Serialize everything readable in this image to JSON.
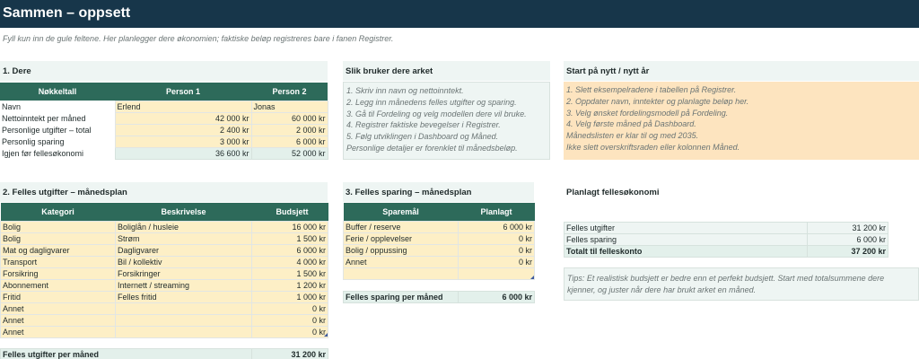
{
  "title": "Sammen – oppsett",
  "subtitle": "Fyll kun inn de gule feltene. Her planlegger dere økonomien; faktiske beløp registreres bare i fanen Registrer.",
  "section1": {
    "heading": "1. Dere",
    "headers": [
      "Nøkkeltall",
      "Person 1",
      "Person 2"
    ],
    "rows": [
      {
        "label": "Navn",
        "p1": "Erlend",
        "p2": "Jonas"
      },
      {
        "label": "Nettoinntekt per måned",
        "p1": "42 000 kr",
        "p2": "60 000 kr"
      },
      {
        "label": "Personlige utgifter – total",
        "p1": "2 400 kr",
        "p2": "2 000 kr"
      },
      {
        "label": "Personlig sparing",
        "p1": "3 000 kr",
        "p2": "6 000 kr"
      },
      {
        "label": "Igjen før felles­økonomi",
        "p1": "36 600 kr",
        "p2": "52 000 kr"
      }
    ]
  },
  "howto": {
    "heading": "Slik bruker dere arket",
    "lines": [
      "1. Skriv inn navn og nettoinntekt.",
      "2. Legg inn månedens felles utgifter og sparing.",
      "3. Gå til Fordeling og velg modellen dere vil bruke.",
      "4. Registrer faktiske bevegelser i Registrer.",
      "5. Følg utviklingen i Dashboard og Måned.",
      "Personlige detaljer er forenklet til månedsbeløp."
    ]
  },
  "restart": {
    "heading": "Start på nytt / nytt år",
    "lines": [
      "1. Slett eksempelradene i tabellen på Registrer.",
      "2. Oppdater navn, inntekter og planlagte beløp her.",
      "3. Velg ønsket fordelingsmodell på Fordeling.",
      "4. Velg første måned på Dashboard.",
      "Månedslisten er klar til og med 2035.",
      "Ikke slett overskriftsraden eller kolonnen Måned."
    ]
  },
  "section2": {
    "heading": "2. Felles utgifter – månedsplan",
    "headers": [
      "Kategori",
      "Beskrivelse",
      "Budsjett"
    ],
    "rows": [
      {
        "cat": "Bolig",
        "desc": "Boliglån / husleie",
        "amt": "16 000 kr"
      },
      {
        "cat": "Bolig",
        "desc": "Strøm",
        "amt": "1 500 kr"
      },
      {
        "cat": "Mat og dagligvarer",
        "desc": "Dagligvarer",
        "amt": "6 000 kr"
      },
      {
        "cat": "Transport",
        "desc": "Bil / kollektiv",
        "amt": "4 000 kr"
      },
      {
        "cat": "Forsikring",
        "desc": "Forsikringer",
        "amt": "1 500 kr"
      },
      {
        "cat": "Abonnement",
        "desc": "Internett / streaming",
        "amt": "1 200 kr"
      },
      {
        "cat": "Fritid",
        "desc": "Felles fritid",
        "amt": "1 000 kr"
      },
      {
        "cat": "Annet",
        "desc": "",
        "amt": "0 kr"
      },
      {
        "cat": "Annet",
        "desc": "",
        "amt": "0 kr"
      },
      {
        "cat": "Annet",
        "desc": "",
        "amt": "0 kr"
      }
    ],
    "total_label": "Felles utgifter per måned",
    "total_value": "31 200 kr"
  },
  "section3": {
    "heading": "3. Felles sparing – månedsplan",
    "headers": [
      "Sparemål",
      "Planlagt"
    ],
    "rows": [
      {
        "goal": "Buffer / reserve",
        "amt": "6 000 kr"
      },
      {
        "goal": "Ferie / opplevelser",
        "amt": "0 kr"
      },
      {
        "goal": "Bolig / oppussing",
        "amt": "0 kr"
      },
      {
        "goal": "Annet",
        "amt": "0 kr"
      },
      {
        "goal": "",
        "amt": ""
      }
    ],
    "total_label": "Felles sparing per måned",
    "total_value": "6 000 kr"
  },
  "planned": {
    "heading": "Planlagt fellesøkonomi",
    "rows": [
      {
        "label": "Felles utgifter",
        "value": "31 200 kr"
      },
      {
        "label": "Felles sparing",
        "value": "6 000 kr"
      }
    ],
    "total_label": "Totalt til felleskonto",
    "total_value": "37 200 kr",
    "tips": [
      "Tips: Et realistisk budsjett er bedre enn et perfekt budsjett. Start med totalsummene dere",
      "kjenner, og juster når dere har brukt arket en måned."
    ]
  }
}
